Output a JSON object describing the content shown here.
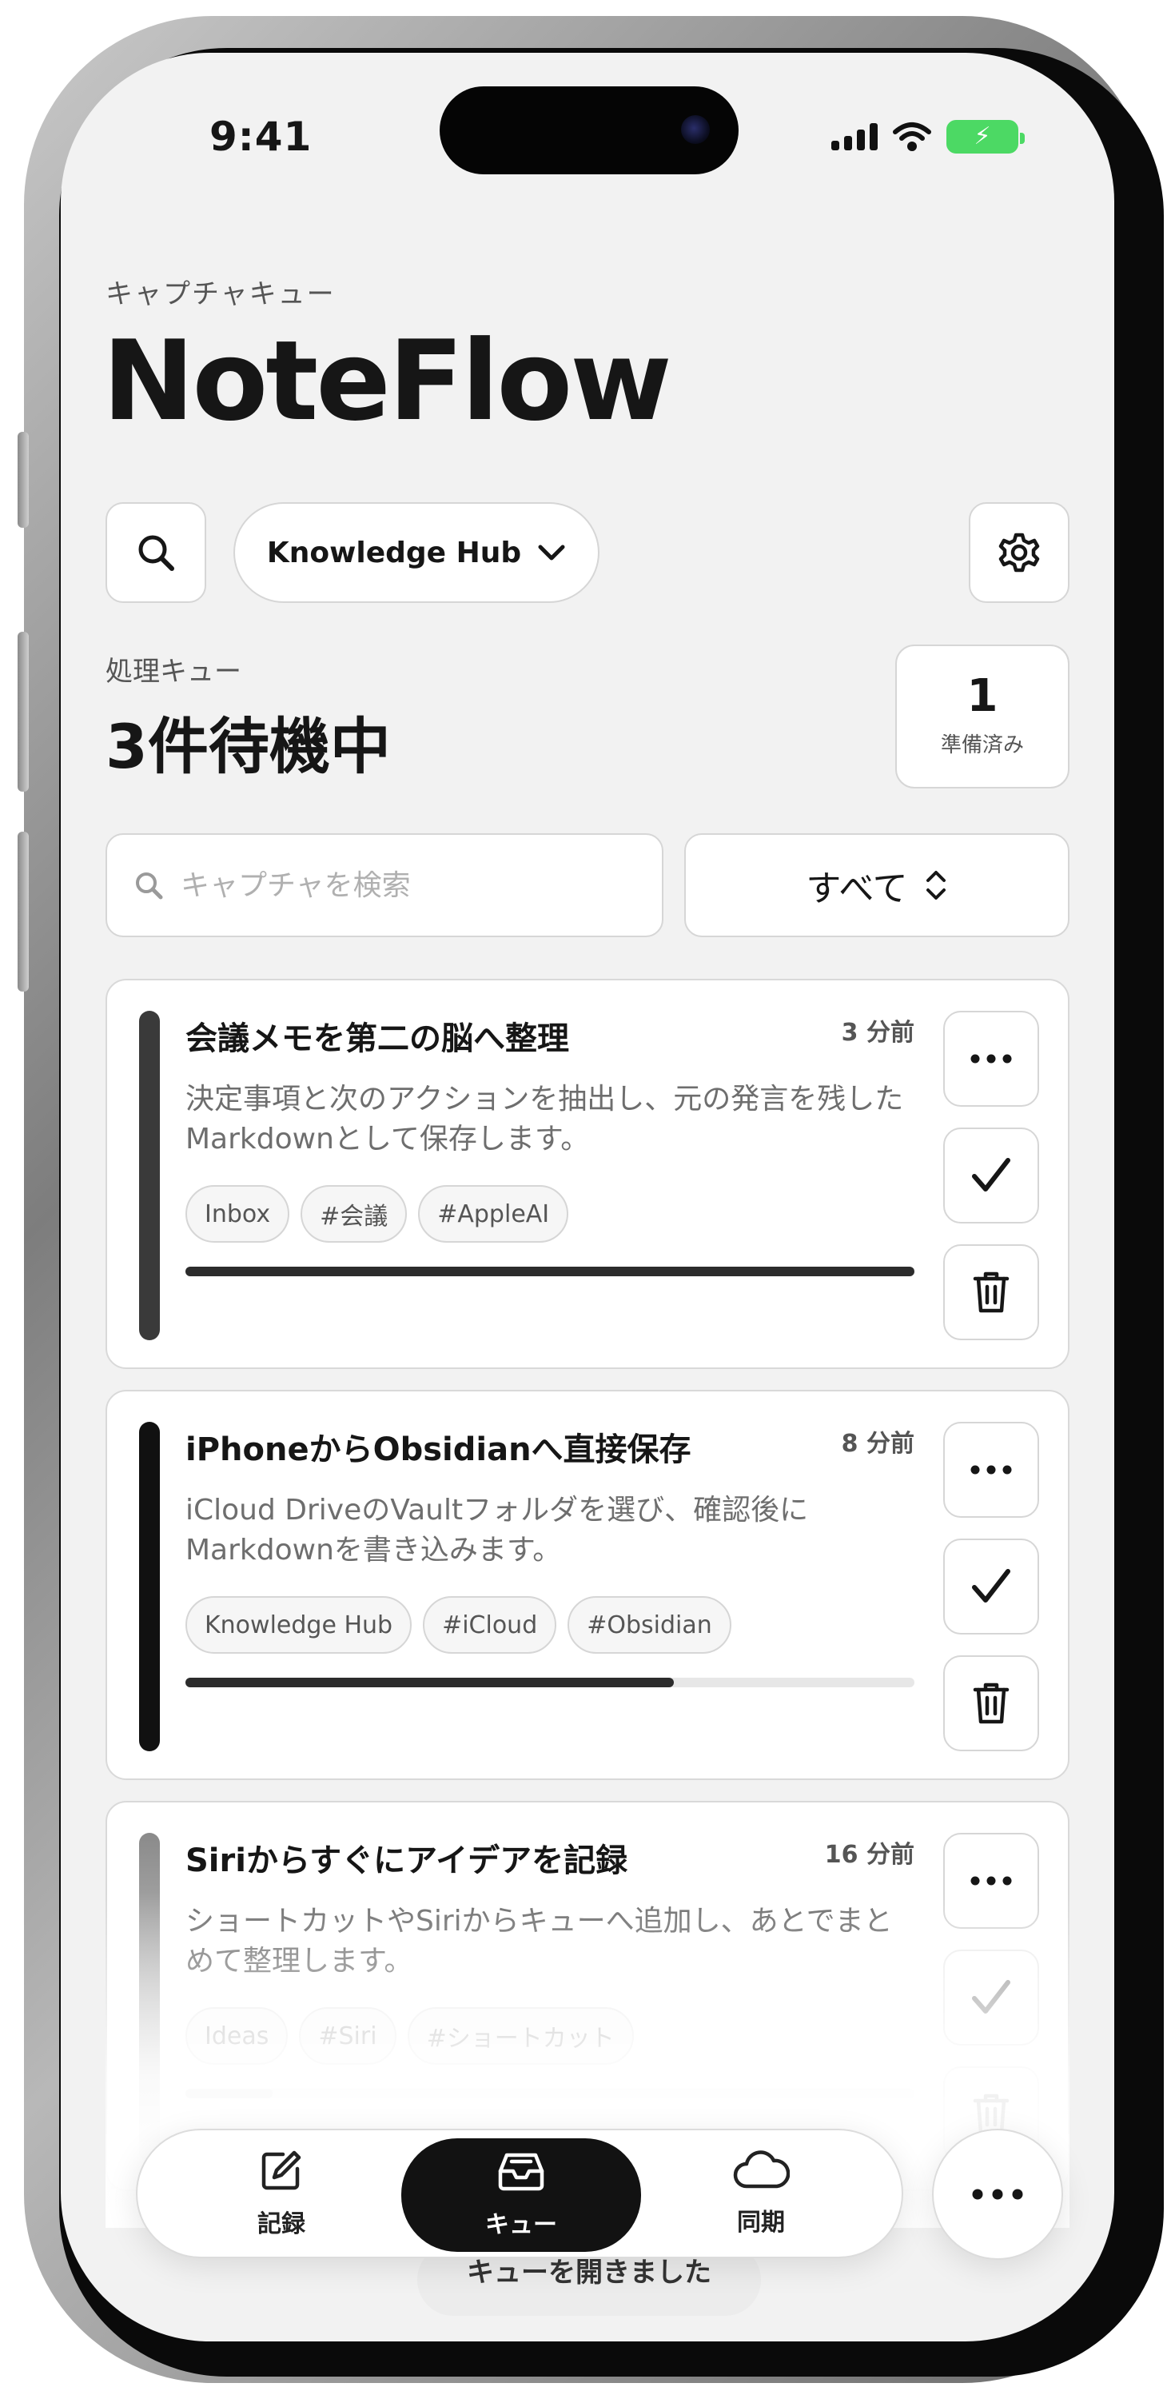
{
  "status_bar": {
    "time": "9:41"
  },
  "header": {
    "eyebrow": "キャプチャキュー",
    "title": "NoteFlow",
    "workspace_selector": "Knowledge Hub"
  },
  "queue": {
    "label": "処理キュー",
    "count_text": "3件待機中",
    "ready_count": "1",
    "ready_label": "準備済み"
  },
  "search": {
    "placeholder": "キャプチャを検索",
    "value": ""
  },
  "filter": {
    "label": "すべて"
  },
  "cards": [
    {
      "title": "会議メモを第二の脳へ整理",
      "time": "3 分前",
      "description": "決定事項と次のアクションを抽出し、元の発言を残したMarkdownとして保存します。",
      "tags": [
        "Inbox",
        "#会議",
        "#AppleAI"
      ],
      "progress": 1.0,
      "accent_color": "#3a3a3a"
    },
    {
      "title": "iPhoneからObsidianへ直接保存",
      "time": "8 分前",
      "description": "iCloud DriveのVaultフォルダを選び、確認後にMarkdownを書き込みます。",
      "tags": [
        "Knowledge Hub",
        "#iCloud",
        "#Obsidian"
      ],
      "progress": 0.67,
      "accent_color": "#111111"
    },
    {
      "title": "Siriからすぐにアイデアを記録",
      "time": "16 分前",
      "description": "ショートカットやSiriからキューへ追加し、あとでまとめて整理します。",
      "tags": [
        "Ideas",
        "#Siri",
        "#ショートカット"
      ],
      "progress": 0.12,
      "accent_color": "#8a8a8a"
    }
  ],
  "tabbar": {
    "tabs": [
      {
        "label": "記録",
        "icon": "compose-icon"
      },
      {
        "label": "キュー",
        "icon": "inbox-tray-icon",
        "active": true
      },
      {
        "label": "同期",
        "icon": "cloud-icon"
      }
    ]
  },
  "toast": {
    "message": "キューを開きました"
  },
  "colors": {
    "background": "#f2f2f2",
    "card": "#ffffff",
    "accent_dark": "#121212",
    "battery": "#4cd964"
  }
}
